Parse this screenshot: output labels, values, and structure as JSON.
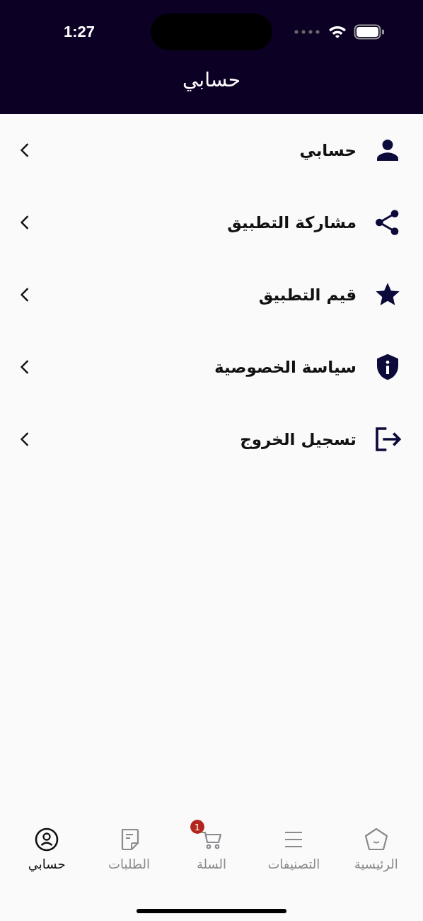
{
  "status_bar": {
    "time": "1:27"
  },
  "header": {
    "title": "حسابي"
  },
  "menu": [
    {
      "label": "حسابي",
      "kind": "person"
    },
    {
      "label": "مشاركة التطبيق",
      "kind": "share"
    },
    {
      "label": "قيم التطبيق",
      "kind": "star"
    },
    {
      "label": "سياسة الخصوصية",
      "kind": "shield"
    },
    {
      "label": "تسجيل الخروج",
      "kind": "logout"
    }
  ],
  "bottom_nav": [
    {
      "label": "الرئيسية",
      "kind": "home",
      "selected": false
    },
    {
      "label": "التصنيفات",
      "kind": "list",
      "selected": false
    },
    {
      "label": "السلة",
      "kind": "cart",
      "selected": false,
      "badge": "1"
    },
    {
      "label": "الطلبات",
      "kind": "orders",
      "selected": false
    },
    {
      "label": "حسابي",
      "kind": "profile",
      "selected": true
    }
  ]
}
